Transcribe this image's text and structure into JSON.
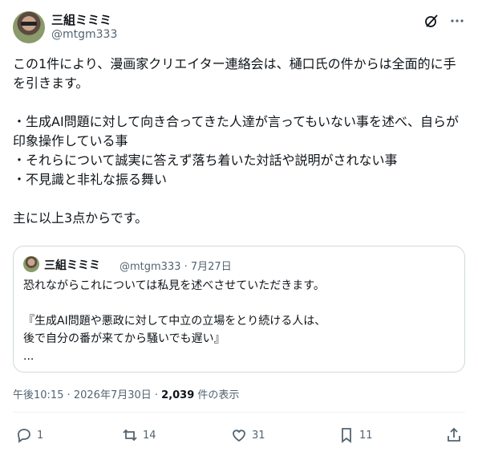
{
  "author": {
    "display_name": "三組ミミミ",
    "handle": "@mtgm333"
  },
  "icons": {
    "grok": "grok-icon",
    "more": "more-dots-icon",
    "reply": "reply-icon",
    "repost": "repost-icon",
    "like": "heart-icon",
    "bookmark": "bookmark-icon",
    "share": "share-icon"
  },
  "post": {
    "text": "この1件により、漫画家クリエイター連絡会は、樋口氏の件からは全面的に手を引きます。\n\n・生成AI問題に対して向き合ってきた人達が言ってもいない事を述べ、自らが印象操作している事\n・それらについて誠実に答えず落ち着いた対話や説明がされない事\n・不見識と非礼な振る舞い\n\n主に以上3点からです。"
  },
  "quote": {
    "display_name": "三組ミミミ",
    "meta": "@mtgm333 · 7月27日",
    "text": "恐れながらこれについては私見を述べさせていただきます。\n\n『生成AI問題や悪政に対して中立の立場をとり続ける人は、\n後で自分の番が来てから騒いでも遅い』\n..."
  },
  "footer": {
    "time": "午後10:15 · 2026年7月30日 · ",
    "views_count": "2,039",
    "views_label": " 件の表示"
  },
  "actions": {
    "reply_count": "1",
    "repost_count": "14",
    "like_count": "31",
    "bookmark_count": "11"
  },
  "colors": {
    "text": "#0f1419",
    "secondary": "#536471",
    "border": "#cfd9de"
  }
}
